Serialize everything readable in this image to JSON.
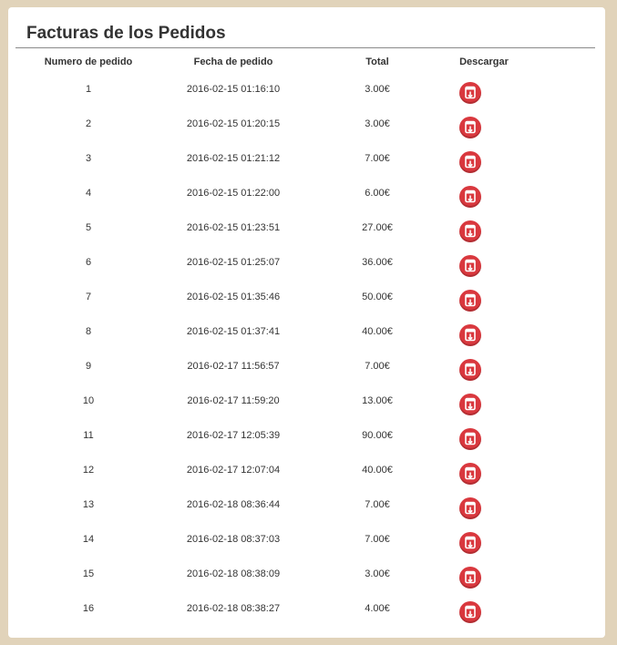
{
  "title": "Facturas de los Pedidos",
  "columns": {
    "order_number": "Numero de pedido",
    "order_date": "Fecha de pedido",
    "total": "Total",
    "download": "Descargar"
  },
  "download_icon": "pdf-download-icon",
  "colors": {
    "background": "#e1d3ba",
    "panel": "#ffffff",
    "download_button": "#d9383e"
  },
  "orders": [
    {
      "number": "1",
      "date": "2016-02-15 01:16:10",
      "total": "3.00€"
    },
    {
      "number": "2",
      "date": "2016-02-15 01:20:15",
      "total": "3.00€"
    },
    {
      "number": "3",
      "date": "2016-02-15 01:21:12",
      "total": "7.00€"
    },
    {
      "number": "4",
      "date": "2016-02-15 01:22:00",
      "total": "6.00€"
    },
    {
      "number": "5",
      "date": "2016-02-15 01:23:51",
      "total": "27.00€"
    },
    {
      "number": "6",
      "date": "2016-02-15 01:25:07",
      "total": "36.00€"
    },
    {
      "number": "7",
      "date": "2016-02-15 01:35:46",
      "total": "50.00€"
    },
    {
      "number": "8",
      "date": "2016-02-15 01:37:41",
      "total": "40.00€"
    },
    {
      "number": "9",
      "date": "2016-02-17 11:56:57",
      "total": "7.00€"
    },
    {
      "number": "10",
      "date": "2016-02-17 11:59:20",
      "total": "13.00€"
    },
    {
      "number": "11",
      "date": "2016-02-17 12:05:39",
      "total": "90.00€"
    },
    {
      "number": "12",
      "date": "2016-02-17 12:07:04",
      "total": "40.00€"
    },
    {
      "number": "13",
      "date": "2016-02-18 08:36:44",
      "total": "7.00€"
    },
    {
      "number": "14",
      "date": "2016-02-18 08:37:03",
      "total": "7.00€"
    },
    {
      "number": "15",
      "date": "2016-02-18 08:38:09",
      "total": "3.00€"
    },
    {
      "number": "16",
      "date": "2016-02-18 08:38:27",
      "total": "4.00€"
    }
  ]
}
